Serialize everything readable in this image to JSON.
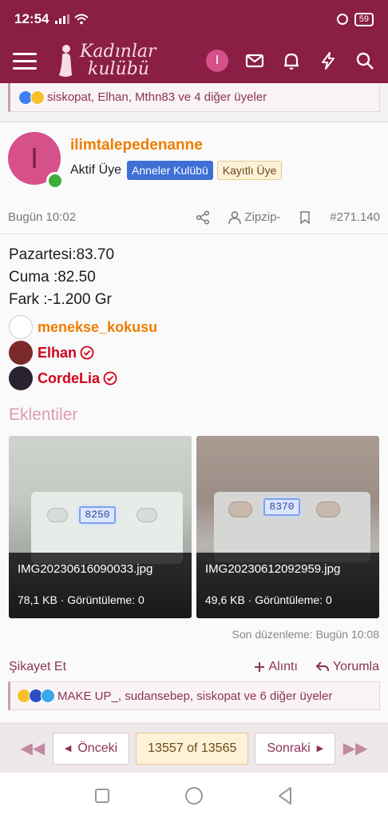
{
  "status_bar": {
    "time": "12:54",
    "battery": "59"
  },
  "header": {
    "logo_line1": "Kadınlar",
    "logo_line2": "kulübü",
    "user_initial": "I"
  },
  "top_reactions": {
    "text": "siskopat, Elhan, Mthn83 ve 4 diğer üyeler"
  },
  "post": {
    "author": {
      "initial": "I",
      "username": "ilimtalepedenanne",
      "title": "Aktif Üye",
      "badge1": "Anneler Kulübü",
      "badge2": "Kayıtlı Üye"
    },
    "meta": {
      "date": "Bugün 10:02",
      "user": "Zipzip-",
      "post_no": "#271.140"
    },
    "lines": [
      "Pazartesi:83.70",
      "Cuma :82.50",
      "Fark :-1.200 Gr"
    ],
    "mentions": [
      {
        "name": "menekse_kokusu",
        "color": "#f07c00"
      },
      {
        "name": "Elhan",
        "color": "#d0021b"
      },
      {
        "name": "CordeLia",
        "color": "#d0021b"
      }
    ],
    "attachments_title": "Eklentiler",
    "attachments": [
      {
        "filename": "IMG20230616090033.jpg",
        "info": "78,1 KB · Görüntüleme: 0",
        "display": "8250"
      },
      {
        "filename": "IMG20230612092959.jpg",
        "info": "49,6 KB · Görüntüleme: 0",
        "display": "8370"
      }
    ],
    "edited": "Son düzenleme: Bugün 10:08",
    "report": "Şikayet Et",
    "quote": "Alıntı",
    "reply": "Yorumla"
  },
  "bottom_reactions": {
    "text": "MAKE UP_, sudansebep, siskopat ve 6 diğer üyeler"
  },
  "pager": {
    "prev": "Önceki",
    "current": "13557 of 13565",
    "next": "Sonraki"
  }
}
